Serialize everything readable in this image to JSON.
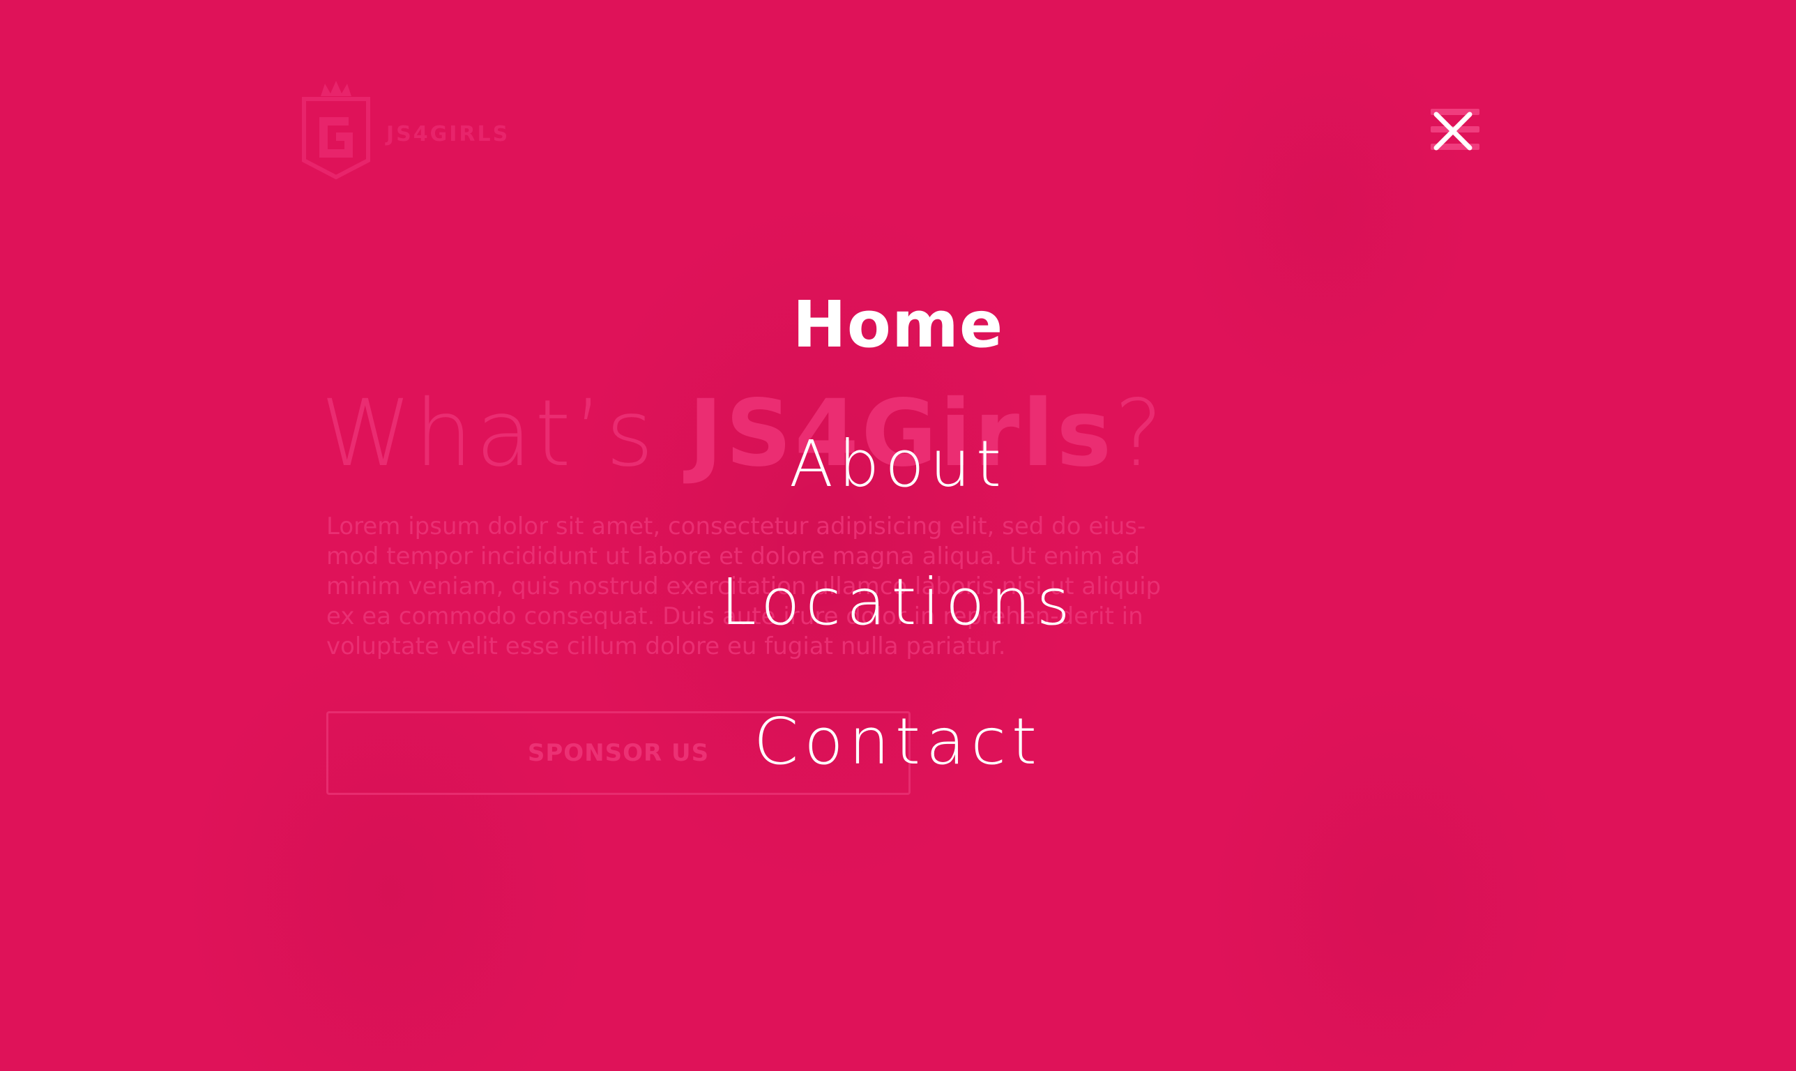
{
  "brand": {
    "name": "JS4GIRLS",
    "logo_icon": "shield-crown-g-logo",
    "background_color": "#df1259"
  },
  "hero": {
    "heading_light": "What’s ",
    "heading_bold": "JS4Girls",
    "heading_end": "?",
    "body": "Lorem ipsum dolor sit amet, consectetur adipisicing elit, sed do eius-mod tempor incididunt ut labore et dolore magna aliqua. Ut enim ad minim veniam, quis nostrud exercitation ullamco laboris nisi ut aliquip ex ea commodo consequat. Duis aute irure dolor in reprehen-derit in voluptate velit esse cillum dolore eu fugiat nulla pariatur.",
    "sponsor_label": "SPONSOR US"
  },
  "overlay_menu": {
    "close_icon": "close-icon",
    "items": [
      {
        "label": "Home",
        "active": true
      },
      {
        "label": "About",
        "active": false
      },
      {
        "label": "Locations",
        "active": false
      },
      {
        "label": "Contact",
        "active": false
      }
    ]
  }
}
